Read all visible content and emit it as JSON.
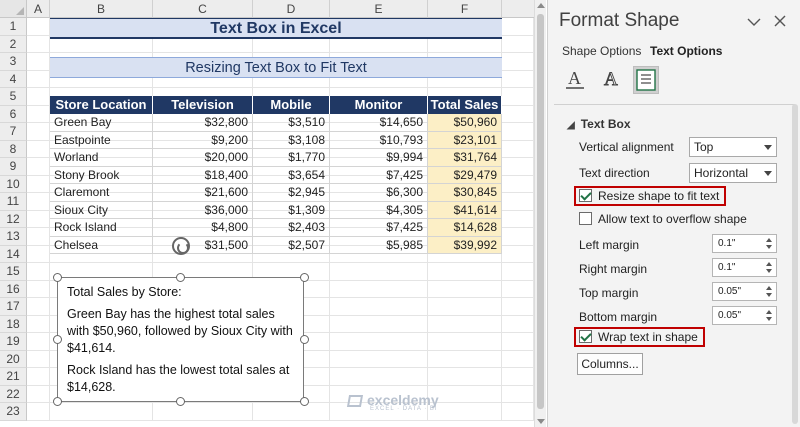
{
  "sheet": {
    "columns": [
      "A",
      "B",
      "C",
      "D",
      "E",
      "F"
    ],
    "rows": [
      "1",
      "2",
      "3",
      "4",
      "5",
      "6",
      "7",
      "8",
      "9",
      "10",
      "11",
      "12",
      "13",
      "14",
      "15",
      "16",
      "17",
      "18",
      "19",
      "20",
      "21",
      "22",
      "23"
    ],
    "title": "Text Box in Excel",
    "subtitle": "Resizing Text Box to Fit Text",
    "table": {
      "headers": [
        "Store Location",
        "Television",
        "Mobile",
        "Monitor",
        "Total Sales"
      ],
      "rows": [
        [
          "Green Bay",
          "$32,800",
          "$3,510",
          "$14,650",
          "$50,960"
        ],
        [
          "Eastpointe",
          "$9,200",
          "$3,108",
          "$10,793",
          "$23,101"
        ],
        [
          "Worland",
          "$20,000",
          "$1,770",
          "$9,994",
          "$31,764"
        ],
        [
          "Stony Brook",
          "$18,400",
          "$3,654",
          "$7,425",
          "$29,479"
        ],
        [
          "Claremont",
          "$21,600",
          "$2,945",
          "$6,300",
          "$30,845"
        ],
        [
          "Sioux City",
          "$36,000",
          "$1,309",
          "$4,305",
          "$41,614"
        ],
        [
          "Rock Island",
          "$4,800",
          "$2,403",
          "$7,425",
          "$14,628"
        ],
        [
          "Chelsea",
          "$31,500",
          "$2,507",
          "$5,985",
          "$39,992"
        ]
      ]
    },
    "textbox": {
      "p1": "Total Sales by Store:",
      "p2": "Green Bay has the highest total sales with $50,960, followed by Sioux City with $41,614.",
      "p3": "Rock Island has the lowest total sales at $14,628."
    },
    "watermark": {
      "brand": "exceldemy",
      "tagline": "EXCEL · DATA · BI"
    }
  },
  "pane": {
    "title": "Format Shape",
    "tabs": [
      "Shape Options",
      "Text Options"
    ],
    "active_tab": "Text Options",
    "section": "Text Box",
    "vertical_alignment": {
      "label": "Vertical alignment",
      "value": "Top"
    },
    "text_direction": {
      "label": "Text direction",
      "value": "Horizontal"
    },
    "resize_shape": {
      "label": "Resize shape to fit text",
      "checked": true
    },
    "allow_overflow": {
      "label": "Allow text to overflow shape",
      "checked": false
    },
    "margins": [
      {
        "label": "Left margin",
        "value": "0.1\""
      },
      {
        "label": "Right margin",
        "value": "0.1\""
      },
      {
        "label": "Top margin",
        "value": "0.05\""
      },
      {
        "label": "Bottom margin",
        "value": "0.05\""
      }
    ],
    "wrap_text": {
      "label": "Wrap text in shape",
      "checked": true
    },
    "columns_button": "Columns...",
    "accent_color": "#c00000"
  },
  "colors": {
    "header_fill": "#203864",
    "title_fill": "#d9e1f2",
    "total_fill": "#fcefc6"
  }
}
